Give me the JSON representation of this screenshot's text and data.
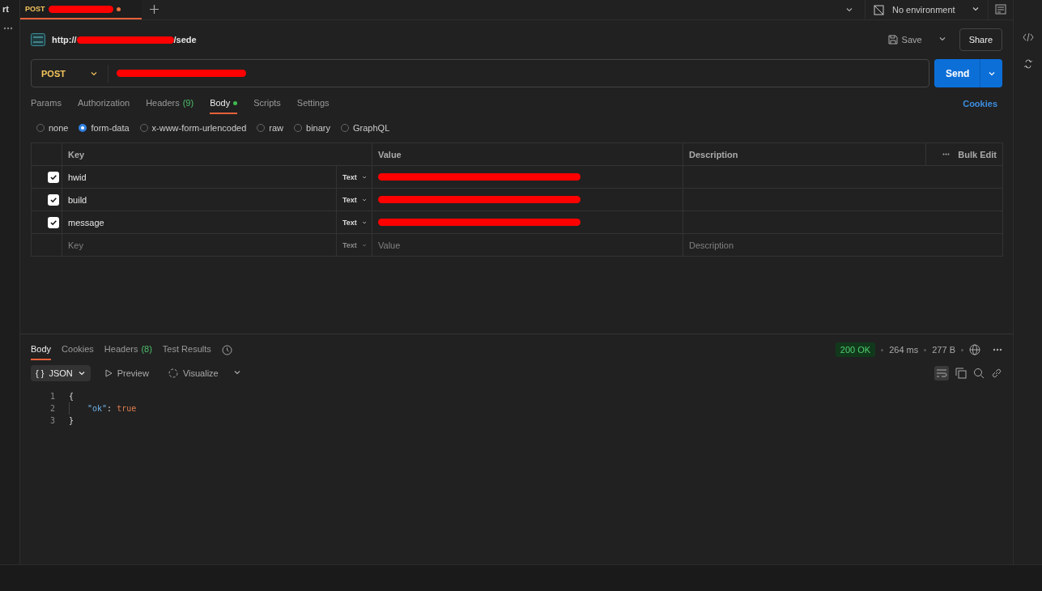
{
  "sidebar": {
    "label": "rt"
  },
  "tabs": [
    {
      "method": "POST",
      "title_redacted": true,
      "unsaved": true,
      "selected": true
    }
  ],
  "environment": {
    "label": "No environment"
  },
  "request": {
    "name_prefix": "http://",
    "name_suffix": "/sede",
    "name_redacted": true,
    "save_label": "Save",
    "share_label": "Share",
    "method": "POST",
    "url_redacted": true,
    "send_label": "Send"
  },
  "request_tabs": [
    {
      "label": "Params",
      "selected": false
    },
    {
      "label": "Authorization",
      "selected": false
    },
    {
      "label": "Headers",
      "count": "(9)",
      "selected": false
    },
    {
      "label": "Body",
      "selected": true,
      "has_content": true
    },
    {
      "label": "Scripts",
      "selected": false
    },
    {
      "label": "Settings",
      "selected": false
    }
  ],
  "cookies_link": "Cookies",
  "body_types": [
    {
      "label": "none",
      "selected": false
    },
    {
      "label": "form-data",
      "selected": true
    },
    {
      "label": "x-www-form-urlencoded",
      "selected": false
    },
    {
      "label": "raw",
      "selected": false
    },
    {
      "label": "binary",
      "selected": false
    },
    {
      "label": "GraphQL",
      "selected": false
    }
  ],
  "params_table": {
    "columns": [
      "Key",
      "Value",
      "Description"
    ],
    "bulk_edit": "Bulk Edit",
    "rows": [
      {
        "checked": true,
        "key": "hwid",
        "type": "Text",
        "value_redacted": true
      },
      {
        "checked": true,
        "key": "build",
        "type": "Text",
        "value_redacted": true
      },
      {
        "checked": true,
        "key": "message",
        "type": "Text",
        "value_redacted": true
      }
    ],
    "placeholder_row": {
      "key": "Key",
      "type": "Text",
      "value": "Value",
      "description": "Description"
    }
  },
  "response": {
    "tabs": [
      {
        "label": "Body",
        "selected": true
      },
      {
        "label": "Cookies",
        "selected": false
      },
      {
        "label": "Headers",
        "count": "(8)",
        "selected": false
      },
      {
        "label": "Test Results",
        "selected": false
      }
    ],
    "status": "200 OK",
    "time": "264 ms",
    "size": "277 B",
    "format_icon": "{ }",
    "format": "JSON",
    "preview": "Preview",
    "visualize": "Visualize",
    "lines": [
      {
        "number": "1",
        "tokens": [
          {
            "kind": "punct",
            "text": "{"
          }
        ]
      },
      {
        "number": "2",
        "tokens": [
          {
            "kind": "key",
            "text": "\"ok\""
          },
          {
            "kind": "punct",
            "text": ": "
          },
          {
            "kind": "bool",
            "text": "true"
          }
        ]
      },
      {
        "number": "3",
        "tokens": [
          {
            "kind": "punct",
            "text": "}"
          }
        ]
      }
    ]
  }
}
